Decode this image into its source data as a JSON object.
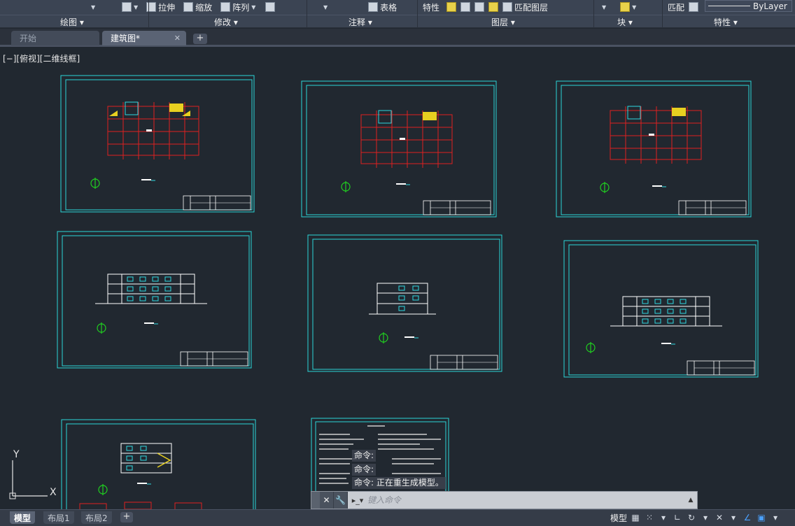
{
  "ribbon": {
    "tools": {
      "stretch": "拉伸",
      "scale": "缩放",
      "array": "阵列",
      "table": "表格",
      "properties": "特性",
      "match_layer": "匹配图层",
      "match": "匹配",
      "bylayer": "ByLayer"
    },
    "panels": [
      "绘图",
      "修改",
      "注释",
      "图层",
      "块",
      "特性"
    ]
  },
  "doc_tabs": [
    {
      "label": "开始",
      "active": false
    },
    {
      "label": "建筑图*",
      "active": true
    }
  ],
  "viewport_label": "[−][俯视][二维线框]",
  "ucs": {
    "x": "X",
    "y": "Y"
  },
  "command": {
    "history": [
      "命令:",
      "命令:",
      "命令: 正在重生成模型。"
    ],
    "placeholder": "键入命令"
  },
  "layout_tabs": [
    {
      "label": "模型",
      "active": true
    },
    {
      "label": "布局1",
      "active": false
    },
    {
      "label": "布局2",
      "active": false
    }
  ],
  "status": {
    "model": "模型"
  },
  "colors": {
    "background": "#212830",
    "sheet_border": "#2ad6d9",
    "grid": "#e02020",
    "marker": "#20d020"
  }
}
